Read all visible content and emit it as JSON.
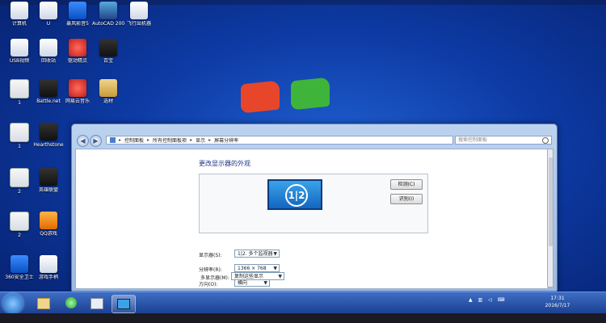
{
  "desktop": {
    "icons": [
      {
        "label": "计算机",
        "color": "white"
      },
      {
        "label": "U",
        "color": "white"
      },
      {
        "label": "暴风影音5",
        "color": "blue"
      },
      {
        "label": "AutoCAD 2007 - S...",
        "color": "teal"
      },
      {
        "label": "飞行出机器",
        "color": "white"
      },
      {
        "label": "USB视频",
        "color": "white"
      },
      {
        "label": "回收站",
        "color": "white"
      },
      {
        "label": "驱动精灵",
        "color": "red"
      },
      {
        "label": "百宝",
        "color": "dark"
      },
      {
        "label": "1",
        "color": "paper"
      },
      {
        "label": "Battle.net",
        "color": "dark"
      },
      {
        "label": "网易云音乐",
        "color": "red"
      },
      {
        "label": "选材",
        "color": "folder"
      },
      {
        "label": "1",
        "color": "paper"
      },
      {
        "label": "Hearthstone",
        "color": "dark"
      },
      {
        "label": "2",
        "color": "paper"
      },
      {
        "label": "英雄联盟",
        "color": "dark"
      },
      {
        "label": "2",
        "color": "paper"
      },
      {
        "label": "QQ游戏",
        "color": "orange"
      },
      {
        "label": "360安全卫士",
        "color": "blue"
      },
      {
        "label": "游戏手柄",
        "color": "white"
      }
    ]
  },
  "window": {
    "breadcrumb": [
      "控制面板",
      "所有控制面板项",
      "显示",
      "屏幕分辨率"
    ],
    "search_placeholder": "搜索控制面板",
    "page_title": "更改显示器的外观",
    "monitor_label": "1|2",
    "detect_button": "检测(C)",
    "identify_button": "识别(I)",
    "rows": {
      "display_label": "显示器(S):",
      "display_value": "1|2. 多个监视器",
      "resolution_label": "分辨率(R):",
      "resolution_value": "1366 × 768",
      "orientation_label": "方向(O):",
      "orientation_value": "横向",
      "multi_label": "多显示器(M):",
      "multi_value": "复制这些显示"
    }
  },
  "taskbar": {
    "time": "17:31",
    "date": "2016/7/17"
  }
}
